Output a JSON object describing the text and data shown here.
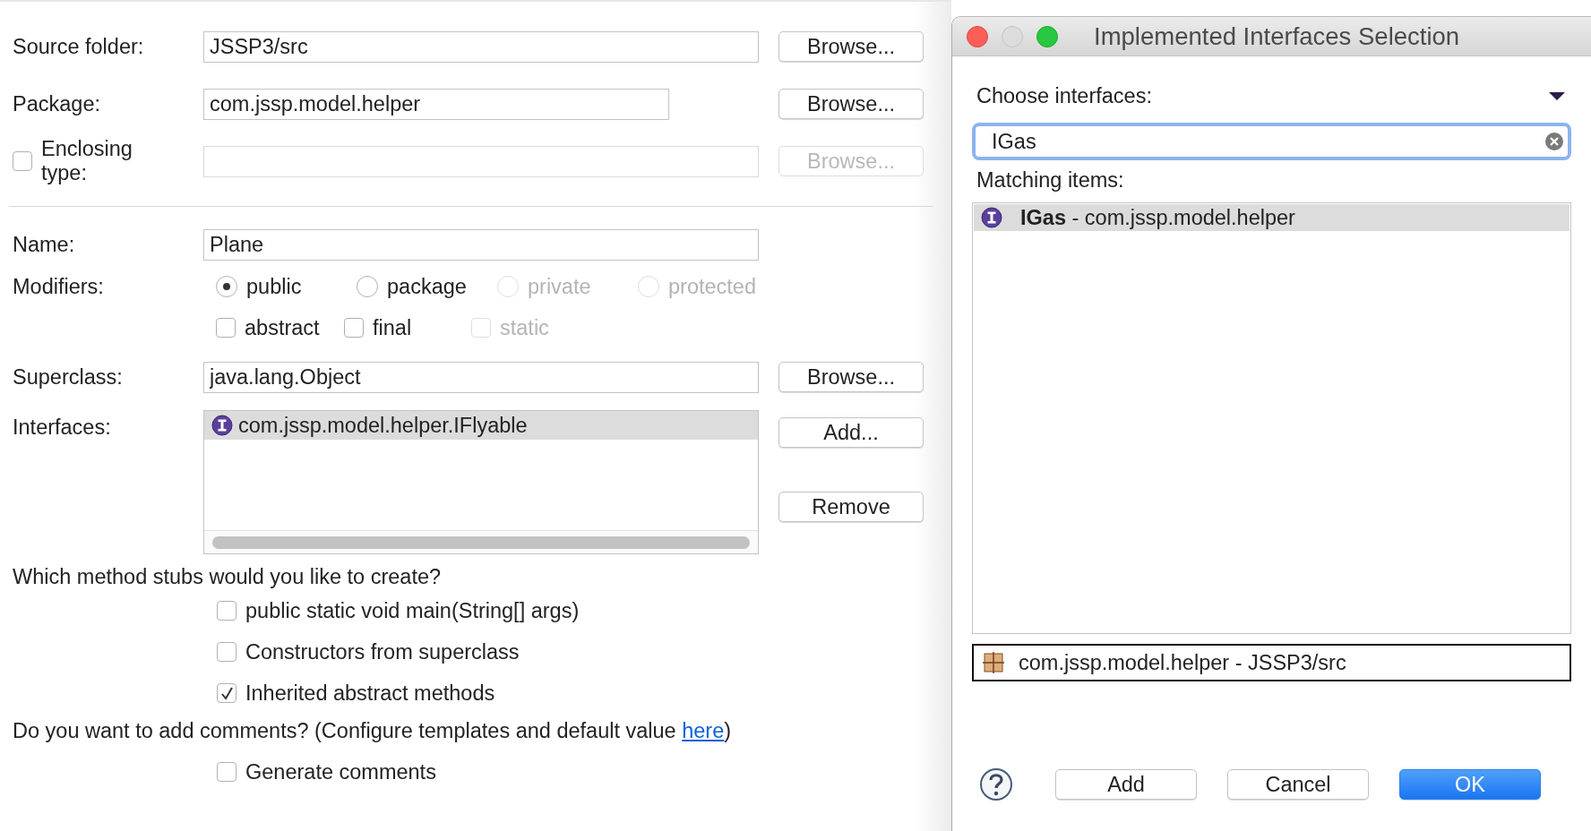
{
  "form": {
    "rows": [
      {
        "kind": "text",
        "label": "Source folder:",
        "value": "JSSP3/src",
        "button": {
          "label": "Browse...",
          "disabled": false
        }
      },
      {
        "kind": "short-text",
        "label": "Package:",
        "value": "com.jssp.model.helper",
        "button": {
          "label": "Browse...",
          "disabled": false
        }
      },
      {
        "kind": "checkbox-text",
        "label": "Enclosing type:",
        "checked": false,
        "disabled": true,
        "button": {
          "label": "Browse...",
          "disabled": true
        }
      }
    ],
    "name": {
      "label": "Name:",
      "value": "Plane"
    },
    "modifiers": {
      "label": "Modifiers:",
      "options": [
        {
          "label": "public",
          "selected": true,
          "disabled": false
        },
        {
          "label": "package",
          "selected": false,
          "disabled": false
        },
        {
          "label": "private",
          "selected": false,
          "disabled": true
        },
        {
          "label": "protected",
          "selected": false,
          "disabled": true
        }
      ],
      "flags": [
        {
          "label": "abstract",
          "checked": false,
          "disabled": false
        },
        {
          "label": "final",
          "checked": false,
          "disabled": false
        },
        {
          "label": "static",
          "checked": false,
          "disabled": true
        }
      ]
    },
    "superclass": {
      "label": "Superclass:",
      "value": "java.lang.Object",
      "button": {
        "label": "Browse...",
        "disabled": false
      }
    },
    "interfaces": {
      "label": "Interfaces:",
      "items": [
        {
          "name": "com.jssp.model.helper.IFlyable",
          "selected": true
        }
      ],
      "buttons": [
        {
          "label": "Add..."
        },
        {
          "label": "Remove"
        }
      ]
    },
    "method_stubs": {
      "question": "Which method stubs would you like to create?",
      "options": [
        {
          "label": "public static void main(String[] args)",
          "checked": false
        },
        {
          "label": "Constructors from superclass",
          "checked": false
        },
        {
          "label": "Inherited abstract methods",
          "checked": true
        }
      ]
    },
    "comments": {
      "text_before": "Do you want to add comments? (Configure templates and default value ",
      "link": "here",
      "text_after": ")",
      "options": [
        {
          "label": "Generate comments",
          "checked": false
        }
      ]
    }
  },
  "dialog": {
    "title": "Implemented Interfaces Selection",
    "controls": [
      {
        "kind": "close",
        "disabled": false
      },
      {
        "kind": "minimize",
        "disabled": true
      },
      {
        "kind": "zoom",
        "disabled": false
      }
    ],
    "choose_label": "Choose interfaces:",
    "filter": {
      "value": "IGas"
    },
    "matching_label": "Matching items:",
    "items": [
      {
        "text": "**IGas** - com.jssp.model.helper",
        "selected": true
      }
    ],
    "details": "com.jssp.model.helper - JSSP3/src",
    "buttons": [
      {
        "label": "Add",
        "kind": "default"
      },
      {
        "label": "Cancel",
        "kind": "default"
      },
      {
        "label": "OK",
        "kind": "primary"
      }
    ]
  }
}
